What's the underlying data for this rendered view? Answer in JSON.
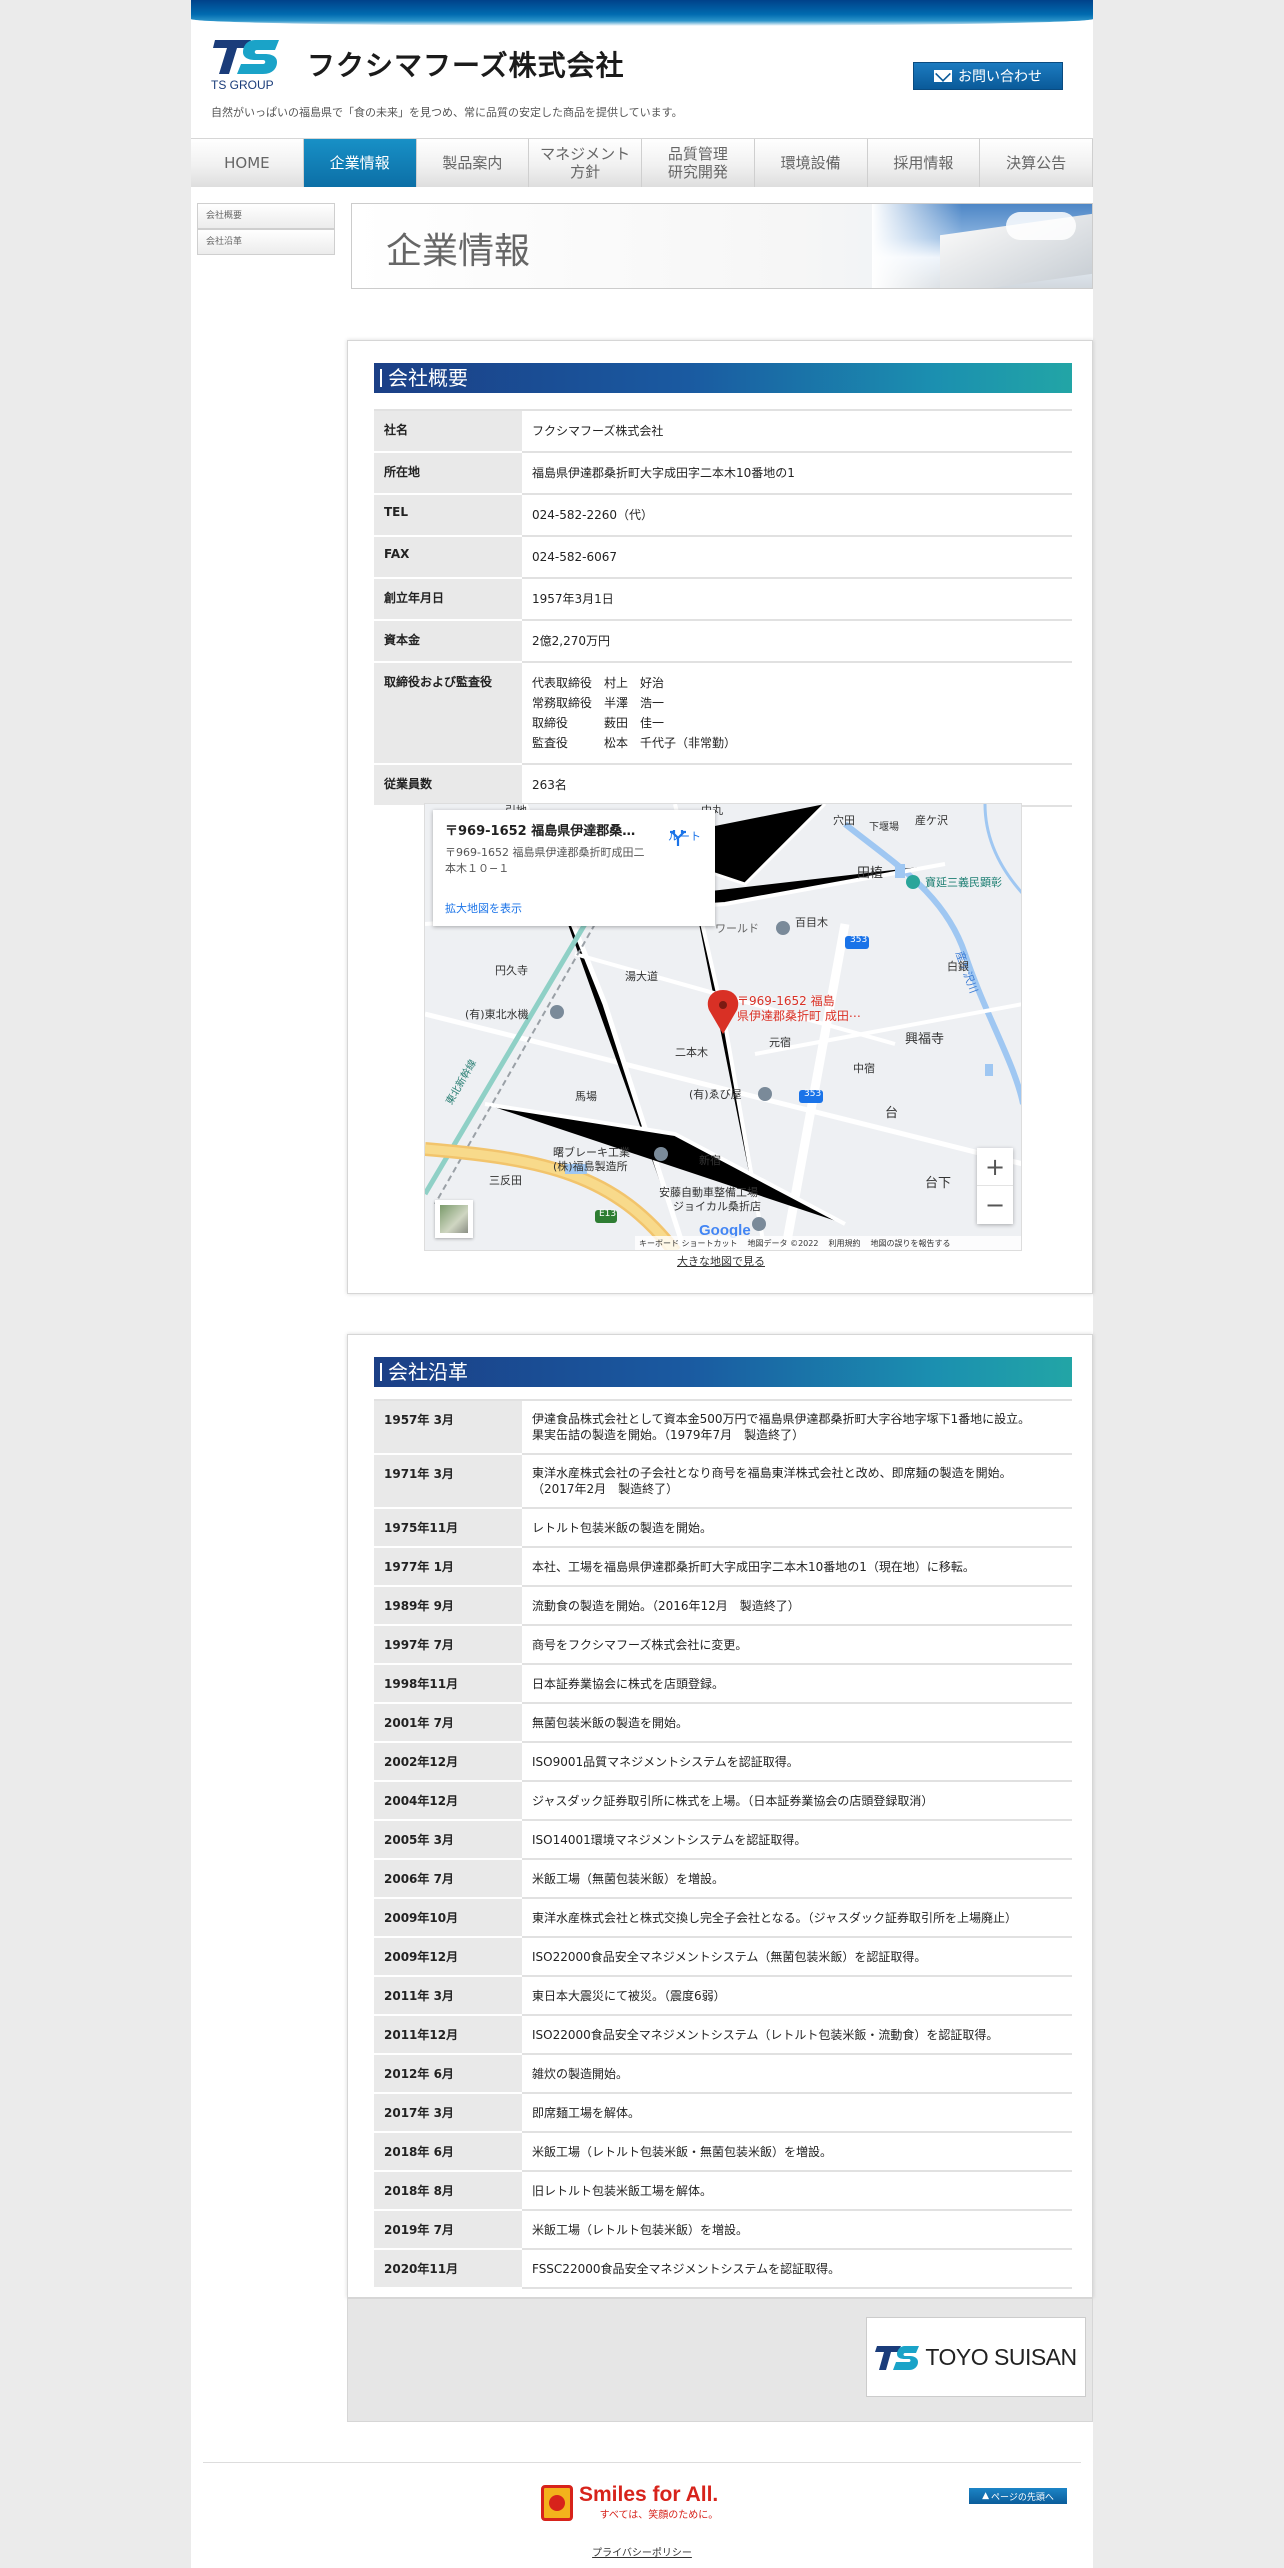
{
  "header": {
    "logo_group": "TS GROUP",
    "company_name": "フクシマフーズ株式会社",
    "tagline": "自然がいっぱいの福島県で「食の未来」を見つめ、常に品質の安定した商品を提供しています。",
    "contact_label": "お問い合わせ"
  },
  "nav": {
    "items": [
      {
        "label": "HOME"
      },
      {
        "label": "企業情報"
      },
      {
        "label": "製品案内"
      },
      {
        "label": "マネジメント\n方針"
      },
      {
        "label": "品質管理\n研究開発"
      },
      {
        "label": "環境設備"
      },
      {
        "label": "採用情報"
      },
      {
        "label": "決算公告"
      }
    ],
    "active_index": 1
  },
  "sidebar": {
    "items": [
      {
        "label": "会社概要"
      },
      {
        "label": "会社沿革"
      }
    ]
  },
  "banner": {
    "title": "企業情報"
  },
  "overview": {
    "title": "会社概要",
    "rows": [
      {
        "label": "社名",
        "value": "フクシマフーズ株式会社"
      },
      {
        "label": "所在地",
        "value": "福島県伊達郡桑折町大字成田字二本木10番地の1"
      },
      {
        "label": "TEL",
        "value": "024-582-2260（代）"
      },
      {
        "label": "FAX",
        "value": "024-582-6067"
      },
      {
        "label": "創立年月日",
        "value": "1957年3月1日"
      },
      {
        "label": "資本金",
        "value": "2億2,270万円"
      }
    ],
    "officers_label": "取締役および監査役",
    "officers": [
      "代表取締役　村上　好治",
      "常務取締役　半澤　浩一",
      "取締役　　　薮田　佳一",
      "監査役　　　松本　千代子（非常勤）"
    ],
    "employees_label": "従業員数",
    "employees_value": "263名"
  },
  "map": {
    "card_title": "〒969-1652 福島県伊達郡桑折...",
    "card_address": "〒969-1652 福島県伊達郡桑折町成田二本木１０−１",
    "card_link": "拡大地図を表示",
    "route_label": "ルート",
    "pin_label_1": "〒969-1652 福島",
    "pin_label_2": "県伊達郡桑折町 成田⋯",
    "labels": {
      "l1": "引地",
      "l2": "中丸",
      "l3": "穴田",
      "l4": "下堰場",
      "l5": "産ケ沢",
      "l6": "田植",
      "l7": "寶延三義民顕彰",
      "l8": "ワールド",
      "l9": "百目木",
      "l10": "円久寺",
      "l11": "湯大道",
      "l12": "産ヶ沢川",
      "l13": "白銀",
      "l14": "(有)東北水機",
      "l15": "元宿",
      "l16": "興福寺",
      "l17": "二本木",
      "l18": "中宿",
      "l19": "馬場",
      "l20": "(有)ゑび屋",
      "l21": "台",
      "l22": "曙ブレーキ工業",
      "l23": "(株)福島製造所",
      "l24": "新宿",
      "l25": "三反田",
      "l26": "安藤自動車整備工場",
      "l27": "ジョイカル桑折店",
      "l28": "台下",
      "l29": "東北新幹線",
      "r1": "353",
      "r2": "353",
      "r3": "E13"
    },
    "google_logo": "Google",
    "footer": [
      "キーボード ショートカット",
      "地図データ ©2022",
      "利用規約",
      "地図の誤りを報告する"
    ],
    "zoom_in": "+",
    "zoom_out": "−",
    "larger_map_link": "大きな地図で見る"
  },
  "history": {
    "title": "会社沿革",
    "rows": [
      {
        "date": "1957年 3月",
        "text": "伊達食品株式会社として資本金500万円で福島県伊達郡桑折町大字谷地字塚下1番地に設立。\n果実缶詰の製造を開始。（1979年7月　製造終了）"
      },
      {
        "date": "1971年 3月",
        "text": "東洋水産株式会社の子会社となり商号を福島東洋株式会社と改め、即席麺の製造を開始。\n（2017年2月　製造終了）"
      },
      {
        "date": "1975年11月",
        "text": "レトルト包装米飯の製造を開始。"
      },
      {
        "date": "1977年 1月",
        "text": "本社、工場を福島県伊達郡桑折町大字成田字二本木10番地の1（現在地）に移転。"
      },
      {
        "date": "1989年 9月",
        "text": "流動食の製造を開始。（2016年12月　製造終了）"
      },
      {
        "date": "1997年 7月",
        "text": "商号をフクシマフーズ株式会社に変更。"
      },
      {
        "date": "1998年11月",
        "text": "日本証券業協会に株式を店頭登録。"
      },
      {
        "date": "2001年 7月",
        "text": "無菌包装米飯の製造を開始。"
      },
      {
        "date": "2002年12月",
        "text": "ISO9001品質マネジメントシステムを認証取得。"
      },
      {
        "date": "2004年12月",
        "text": "ジャスダック証券取引所に株式を上場。（日本証券業協会の店頭登録取消）"
      },
      {
        "date": "2005年 3月",
        "text": "ISO14001環境マネジメントシステムを認証取得。"
      },
      {
        "date": "2006年 7月",
        "text": "米飯工場（無菌包装米飯）を増設。"
      },
      {
        "date": "2009年10月",
        "text": "東洋水産株式会社と株式交換し完全子会社となる。（ジャスダック証券取引所を上場廃止）"
      },
      {
        "date": "2009年12月",
        "text": "ISO22000食品安全マネジメントシステム（無菌包装米飯）を認証取得。"
      },
      {
        "date": "2011年 3月",
        "text": "東日本大震災にて被災。（震度6弱）"
      },
      {
        "date": "2011年12月",
        "text": "ISO22000食品安全マネジメントシステム（レトルト包装米飯・流動食）を認証取得。"
      },
      {
        "date": "2012年 6月",
        "text": "雑炊の製造開始。"
      },
      {
        "date": "2017年 3月",
        "text": "即席麺工場を解体。"
      },
      {
        "date": "2018年 6月",
        "text": "米飯工場（レトルト包装米飯・無菌包装米飯）を増設。"
      },
      {
        "date": "2018年 8月",
        "text": "旧レトルト包装米飯工場を解体。"
      },
      {
        "date": "2019年 7月",
        "text": "米飯工場（レトルト包装米飯）を増設。"
      },
      {
        "date": "2020年11月",
        "text": "FSSC22000食品安全マネジメントシステムを認証取得。"
      }
    ]
  },
  "footer": {
    "toyo_label": "TOYO SUISAN",
    "smiles_main": "Smiles for All.",
    "smiles_sub": "すべては、笑顔のために。",
    "pagetop_label": "ページの先頭へ",
    "privacy_label": "プライバシーポリシー"
  },
  "colors": {
    "brand_blue": "#0c6fa6",
    "title_bar_start": "#1b3f86",
    "title_bar_end": "#22a5a6",
    "smiles_red": "#d7231b"
  }
}
